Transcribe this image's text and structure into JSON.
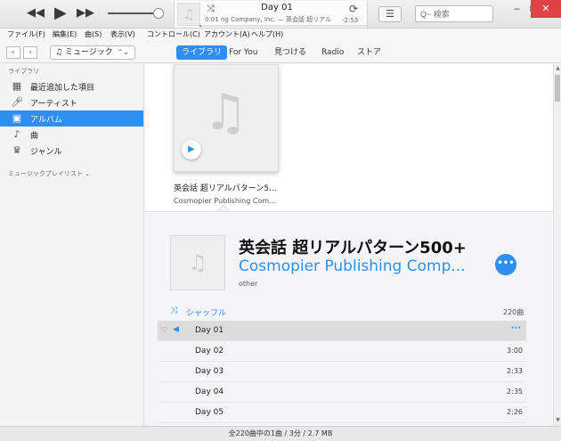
{
  "player": {
    "prev_icon": "rewind-icon",
    "play_icon": "play-icon",
    "next_icon": "fast-forward-icon",
    "volume_level": 0.92,
    "now_playing": {
      "title": "Day 01",
      "subtitle": "ng Company, Inc. — 英会話 超リアル",
      "elapsed": "0:01",
      "remaining": "-2:53",
      "progress": 0.01
    },
    "search_placeholder": "Q~ 検索"
  },
  "menu": [
    "ファイル(F)",
    "編集(E)",
    "曲(S)",
    "表示(V)",
    "コントロール(C)",
    "アカウント(A)",
    "ヘルプ(H)"
  ],
  "nav": {
    "media_picker": "ミュージック",
    "tabs": [
      "ライブラリ",
      "For You",
      "見つける",
      "Radio",
      "ストア"
    ],
    "active_tab": 0
  },
  "sidebar": {
    "library_heading": "ライブラリ",
    "items": [
      {
        "label": "最近追加した項目",
        "icon": "grid-calendar-icon"
      },
      {
        "label": "アーティスト",
        "icon": "microphone-icon"
      },
      {
        "label": "アルバム",
        "icon": "album-icon"
      },
      {
        "label": "曲",
        "icon": "music-note-icon"
      },
      {
        "label": "ジャンル",
        "icon": "genre-icon"
      }
    ],
    "selected_index": 2,
    "playlists_heading": "ミュージックプレイリスト ⌄"
  },
  "album_tile": {
    "title": "英会話 超リアルパターン5...",
    "artist": "Cosmopier Publishing Com..."
  },
  "album_detail": {
    "title": "英会話 超リアルパターン500+",
    "artist": "Cosmopier Publishing Comp...",
    "genre": "other",
    "shuffle_label": "シャッフル",
    "song_count": "220曲",
    "tracks": [
      {
        "name": "Day 01",
        "duration": "",
        "playing": true
      },
      {
        "name": "Day 02",
        "duration": "3:00",
        "playing": false
      },
      {
        "name": "Day 03",
        "duration": "2:33",
        "playing": false
      },
      {
        "name": "Day 04",
        "duration": "2:35",
        "playing": false
      },
      {
        "name": "Day 05",
        "duration": "2:26",
        "playing": false
      }
    ]
  },
  "status": "全220曲中の1曲 / 3分 / 2.7 MB"
}
